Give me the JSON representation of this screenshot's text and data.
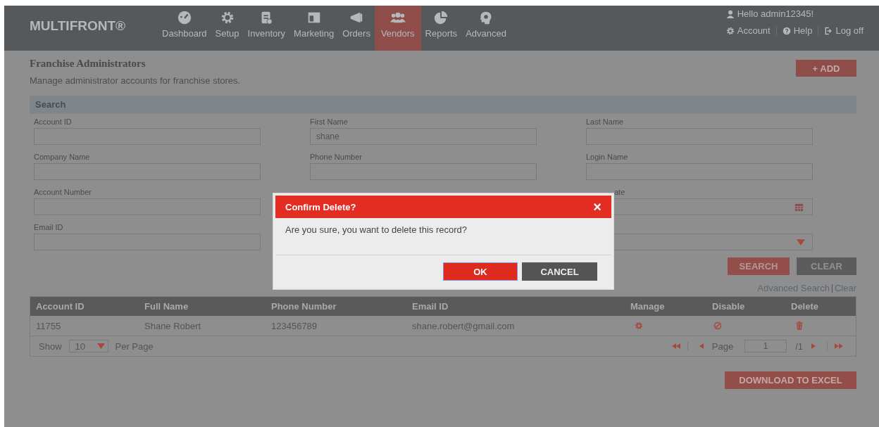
{
  "header": {
    "logo": "MULTIFRONT®",
    "nav": [
      {
        "label": "Dashboard",
        "selected": false
      },
      {
        "label": "Setup",
        "selected": false
      },
      {
        "label": "Inventory",
        "selected": false
      },
      {
        "label": "Marketing",
        "selected": false
      },
      {
        "label": "Orders",
        "selected": false
      },
      {
        "label": "Vendors",
        "selected": true
      },
      {
        "label": "Reports",
        "selected": false
      },
      {
        "label": "Advanced",
        "selected": false
      }
    ],
    "greeting": "Hello admin12345!",
    "links": [
      "Account",
      "Help",
      "Log off"
    ]
  },
  "page": {
    "title": "Franchise Administrators",
    "subtitle": "Manage administrator accounts for franchise stores.",
    "add_button": "+ ADD"
  },
  "search": {
    "title": "Search",
    "rows": [
      [
        {
          "label": "Account ID",
          "kind": "text"
        },
        {
          "label": "First Name",
          "kind": "text",
          "value": "shane"
        },
        {
          "label": "Last Name",
          "kind": "text"
        }
      ],
      [
        {
          "label": "Company Name",
          "kind": "text"
        },
        {
          "label": "Phone Number",
          "kind": "text"
        },
        {
          "label": "Login Name",
          "kind": "text"
        }
      ],
      [
        {
          "label": "Account Number",
          "kind": "text"
        },
        null,
        {
          "label": "ate",
          "kind": "date",
          "covered": true
        }
      ],
      [
        {
          "label": "Email ID",
          "kind": "text"
        },
        null,
        {
          "kind": "select"
        }
      ]
    ],
    "buttons": [
      {
        "label": "SEARCH",
        "kind": "primary"
      },
      {
        "label": "CLEAR",
        "kind": "secondary"
      }
    ],
    "links": [
      "Advanced Search",
      "Clear"
    ]
  },
  "table": {
    "columns": [
      "Account ID",
      "Full Name",
      "Phone Number",
      "Email ID",
      "Manage",
      "Disable",
      "Delete"
    ],
    "rows": [
      {
        "cells": [
          "11755",
          "Shane Robert",
          "123456789",
          "shane.robert@gmail.com"
        ]
      }
    ],
    "footer": {
      "show": "Show",
      "per_page_value": "10",
      "per_page": "Per Page",
      "page": "Page",
      "page_value": "1",
      "total": "/1"
    }
  },
  "download_button": "DOWNLOAD TO EXCEL",
  "dialog": {
    "title": "Confirm Delete?",
    "close": "×",
    "message": "Are you sure, you want to delete this record?",
    "buttons": [
      {
        "label": "OK",
        "kind": "primary"
      },
      {
        "label": "CANCEL",
        "kind": "secondary"
      }
    ]
  }
}
